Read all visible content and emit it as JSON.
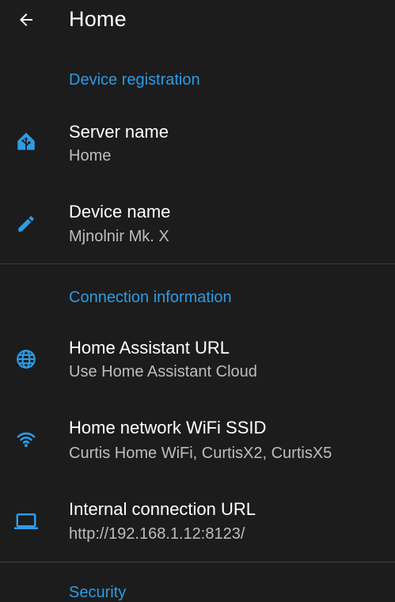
{
  "appbar": {
    "title": "Home",
    "back_icon": "arrow-back-icon"
  },
  "sections": {
    "device_registration": {
      "header": "Device registration",
      "items": [
        {
          "icon": "home-assistant-icon",
          "title": "Server name",
          "subtitle": "Home"
        },
        {
          "icon": "pencil-icon",
          "title": "Device name",
          "subtitle": "Mjnolnir Mk. X"
        }
      ]
    },
    "connection_information": {
      "header": "Connection information",
      "items": [
        {
          "icon": "globe-icon",
          "title": "Home Assistant URL",
          "subtitle": "Use Home Assistant Cloud"
        },
        {
          "icon": "wifi-icon",
          "title": "Home network WiFi SSID",
          "subtitle": "Curtis Home WiFi, CurtisX2, CurtisX5"
        },
        {
          "icon": "laptop-icon",
          "title": "Internal connection URL",
          "subtitle": "http://192.168.1.12:8123/"
        }
      ]
    },
    "security": {
      "header": "Security"
    }
  },
  "colors": {
    "background": "#1c1c1c",
    "accent": "#2d9be6",
    "divider": "#3e3e3e",
    "secondary_text": "#bdbdbd"
  }
}
